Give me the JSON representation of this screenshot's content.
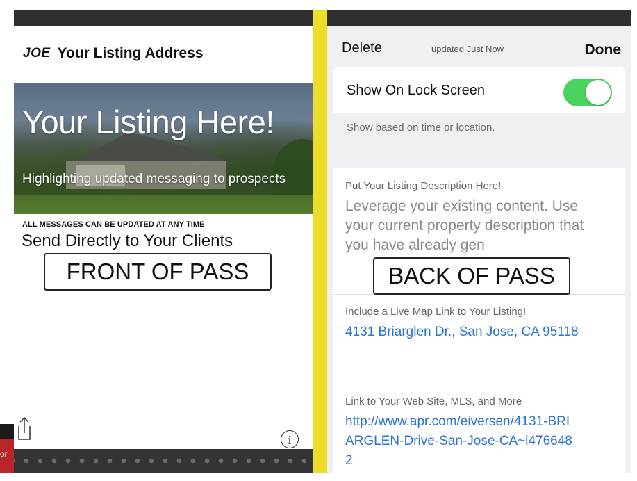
{
  "front": {
    "logo": "JOE",
    "title": "Your Listing Address",
    "hero_title": "Your Listing Here!",
    "hero_subtitle": "Highlighting updated messaging to prospects",
    "caps_note": "ALL MESSAGES CAN BE UPDATED AT ANY TIME",
    "send_line": "Send Directly to Your Clients",
    "stamp": "FRONT OF PASS",
    "info_glyph": "i",
    "edge_text": "or",
    "icons": [
      "share-icon",
      "info-icon"
    ]
  },
  "back": {
    "delete_label": "Delete",
    "updated_text": "updated Just Now",
    "done_label": "Done",
    "lock_label": "Show On Lock Screen",
    "lock_enabled": true,
    "lock_hint": "Show based on time or location.",
    "description_label": "Put Your Listing Description Here!",
    "description_body": "Leverage your existing content. Use your current property description that you have already gen",
    "stamp": "BACK OF PASS",
    "map_label": "Include a Live Map Link to Your Listing!",
    "map_link": "4131 Briarglen Dr., San Jose, CA 95118",
    "web_label": "Link to Your Web Site, MLS, and More",
    "web_link": "http://www.apr.com/eiversen/4131-BRIARGLEN-Drive-San-Jose-CA~l4766482"
  },
  "colors": {
    "divider_yellow": "#ecdd2a",
    "toggle_green": "#4bd35f",
    "link_blue": "#2a76d6",
    "bar_dark": "#2f2f2f"
  }
}
